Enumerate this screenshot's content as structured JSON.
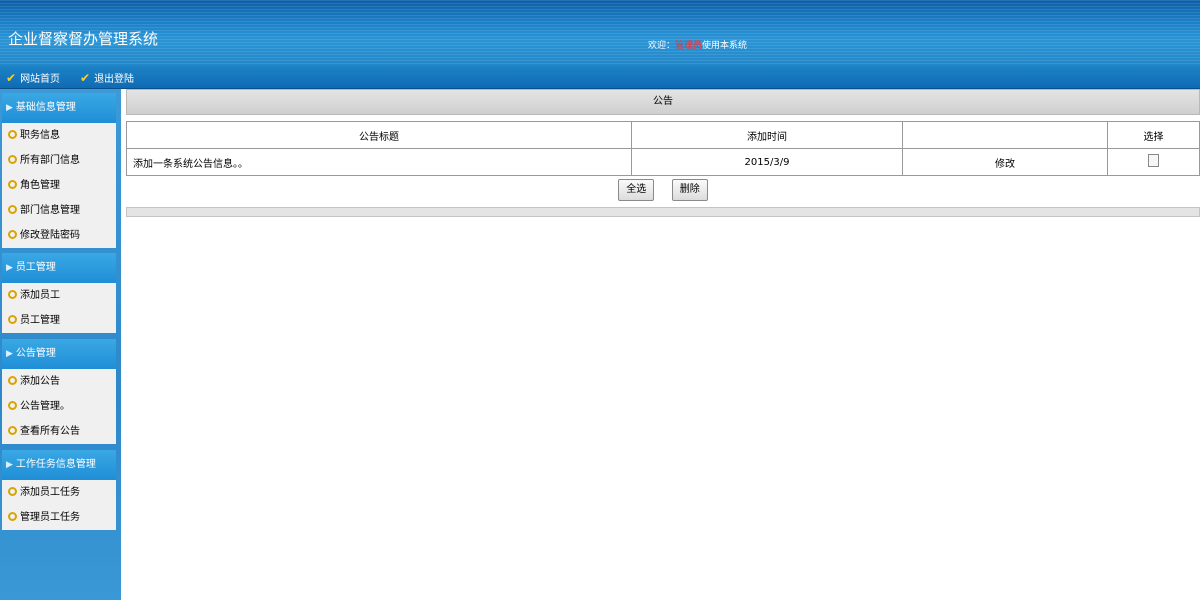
{
  "header": {
    "app_title": "企业督察督办管理系统",
    "welcome_prefix": "欢迎：",
    "welcome_user": "管理员",
    "welcome_suffix": "使用本系统"
  },
  "nav": {
    "home_label": "网站首页",
    "logout_label": "退出登陆"
  },
  "sidebar": {
    "groups": [
      {
        "title": "基础信息管理",
        "items": [
          "职务信息",
          "所有部门信息",
          "角色管理",
          "部门信息管理",
          "修改登陆密码"
        ]
      },
      {
        "title": "员工管理",
        "items": [
          "添加员工",
          "员工管理"
        ]
      },
      {
        "title": "公告管理",
        "items": [
          "添加公告",
          "公告管理。",
          "查看所有公告"
        ]
      },
      {
        "title": "工作任务信息管理",
        "items": [
          "添加员工任务",
          "管理员工任务"
        ]
      }
    ]
  },
  "main": {
    "panel_title": "公告",
    "columns": [
      "公告标题",
      "添加时间",
      "",
      "选择"
    ],
    "rows": [
      {
        "title": "添加一条系统公告信息。。",
        "date": "2015/3/9",
        "action": "修改",
        "checked": false
      }
    ],
    "select_all_label": "全选",
    "delete_label": "删除"
  },
  "colors": {
    "header_blue": "#1a7cc4",
    "welcome_user_red": "#ff2a2a",
    "bullet_gold": "#d9a400"
  }
}
